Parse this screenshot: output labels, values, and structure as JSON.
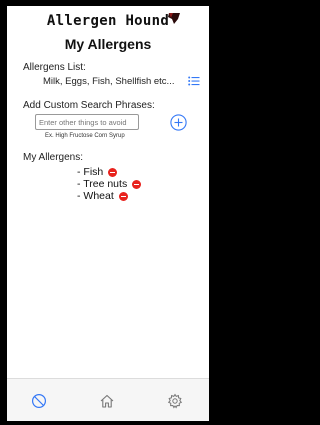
{
  "app": {
    "name": "Allergen Hound",
    "accent_color": "#3478f6",
    "remove_color": "#e8221d"
  },
  "page": {
    "title": "My Allergens"
  },
  "allergens_list": {
    "label": "Allergens List:",
    "value": "Milk, Eggs, Fish, Shellfish etc...",
    "icon": "list-icon"
  },
  "custom_search": {
    "label": "Add Custom Search Phrases:",
    "placeholder": "Enter other things to avoid",
    "value": "",
    "hint": "Ex. High Fructose Corn Syrup",
    "add_icon": "plus-circle-icon"
  },
  "my_allergens": {
    "label": "My Allergens:",
    "items": [
      {
        "label": "- Fish"
      },
      {
        "label": "- Tree nuts"
      },
      {
        "label": "- Wheat"
      }
    ],
    "remove_icon": "minus-circle-icon"
  },
  "tabbar": {
    "tabs": [
      {
        "icon": "no-entry-icon",
        "active": true
      },
      {
        "icon": "home-icon",
        "active": false
      },
      {
        "icon": "gear-icon",
        "active": false
      }
    ]
  }
}
